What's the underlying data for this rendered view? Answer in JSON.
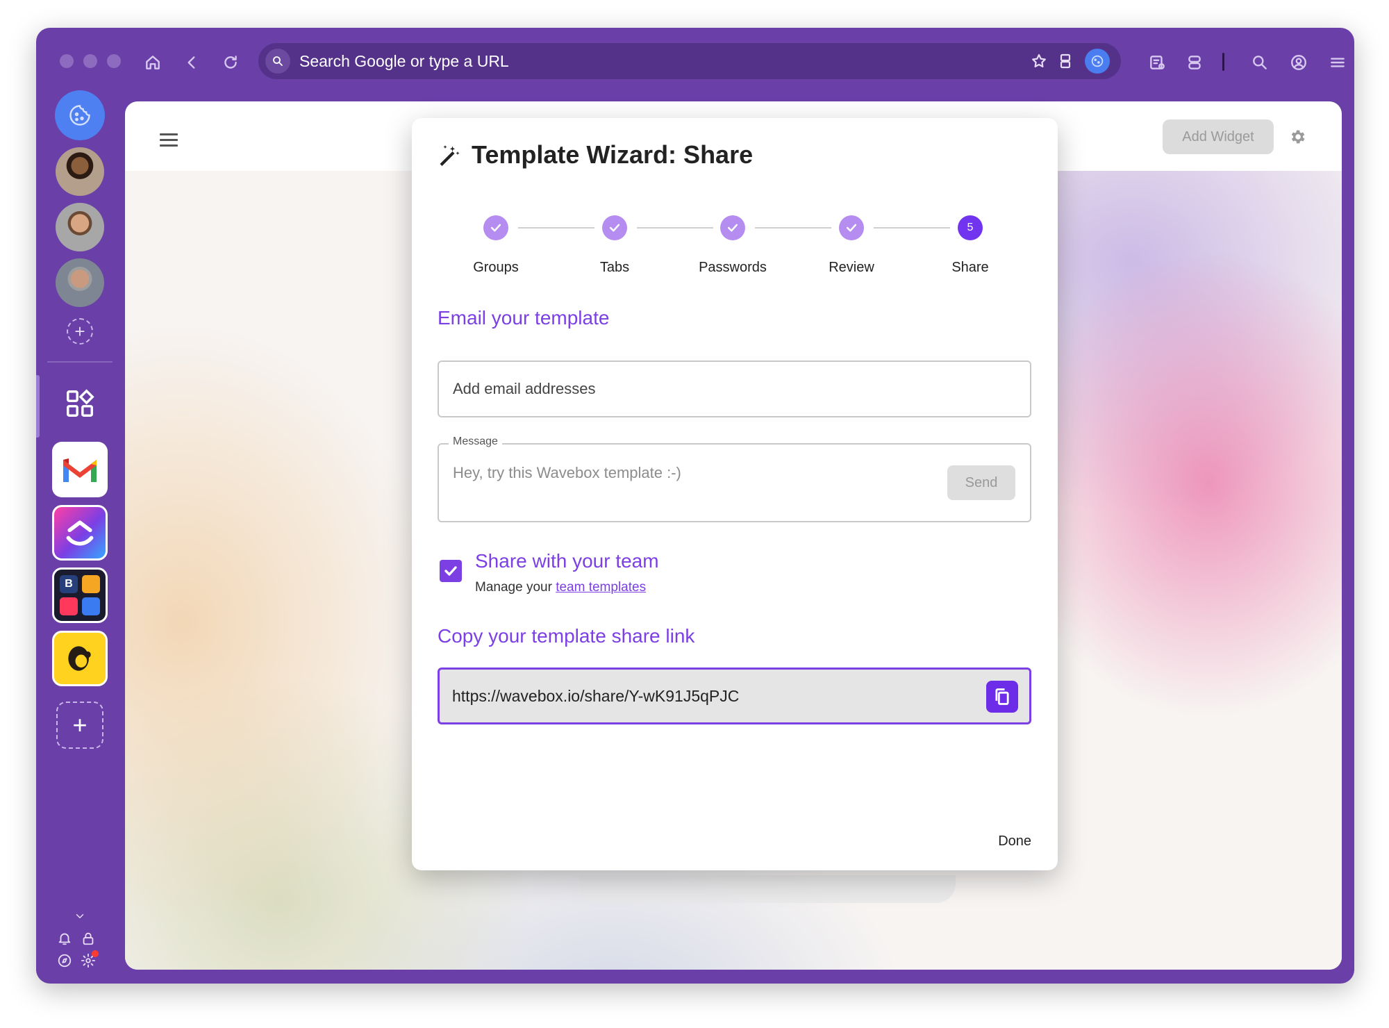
{
  "browser": {
    "url_placeholder": "Search Google or type a URL"
  },
  "page": {
    "add_widget_label": "Add Widget"
  },
  "dialog": {
    "title": "Template Wizard: Share",
    "steps": [
      {
        "label": "Groups",
        "state": "complete"
      },
      {
        "label": "Tabs",
        "state": "complete"
      },
      {
        "label": "Passwords",
        "state": "complete"
      },
      {
        "label": "Review",
        "state": "complete"
      },
      {
        "label": "Share",
        "state": "current",
        "number": "5"
      }
    ],
    "email_section": {
      "heading": "Email your template",
      "email_placeholder": "Add email addresses",
      "message_label": "Message",
      "message_placeholder": "Hey, try this Wavebox template :-)",
      "send_label": "Send"
    },
    "team_section": {
      "checkbox_checked": true,
      "label": "Share with your team",
      "manage_prefix": "Manage your ",
      "manage_link": "team templates"
    },
    "link_section": {
      "heading": "Copy your template share link",
      "share_url": "https://wavebox.io/share/Y-wK91J5qPJC"
    },
    "done_label": "Done"
  },
  "colors": {
    "accent": "#7b3fe4",
    "window_frame": "#6a3fa8"
  }
}
